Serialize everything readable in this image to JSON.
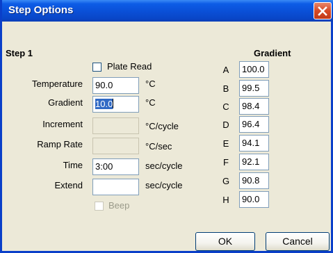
{
  "window": {
    "title": "Step Options"
  },
  "step": {
    "heading": "Step 1",
    "plate_read_label": "Plate Read",
    "beep_label": "Beep"
  },
  "params": {
    "temperature": {
      "label": "Temperature",
      "value": "90.0",
      "unit": "°C"
    },
    "gradient": {
      "label": "Gradient",
      "value": "10.0",
      "unit": "°C"
    },
    "increment": {
      "label": "Increment",
      "value": "",
      "unit": "°C/cycle"
    },
    "ramp_rate": {
      "label": "Ramp Rate",
      "value": "",
      "unit": "°C/sec"
    },
    "time": {
      "label": "Time",
      "value": "3:00",
      "unit": "sec/cycle"
    },
    "extend": {
      "label": "Extend",
      "value": "",
      "unit": "sec/cycle"
    }
  },
  "gradient_table": {
    "heading": "Gradient",
    "rows": [
      {
        "letter": "A",
        "value": "100.0"
      },
      {
        "letter": "B",
        "value": "99.5"
      },
      {
        "letter": "C",
        "value": "98.4"
      },
      {
        "letter": "D",
        "value": "96.4"
      },
      {
        "letter": "E",
        "value": "94.1"
      },
      {
        "letter": "F",
        "value": "92.1"
      },
      {
        "letter": "G",
        "value": "90.8"
      },
      {
        "letter": "H",
        "value": "90.0"
      }
    ]
  },
  "buttons": {
    "ok": "OK",
    "cancel": "Cancel"
  },
  "icons": {
    "close": "close-icon"
  }
}
